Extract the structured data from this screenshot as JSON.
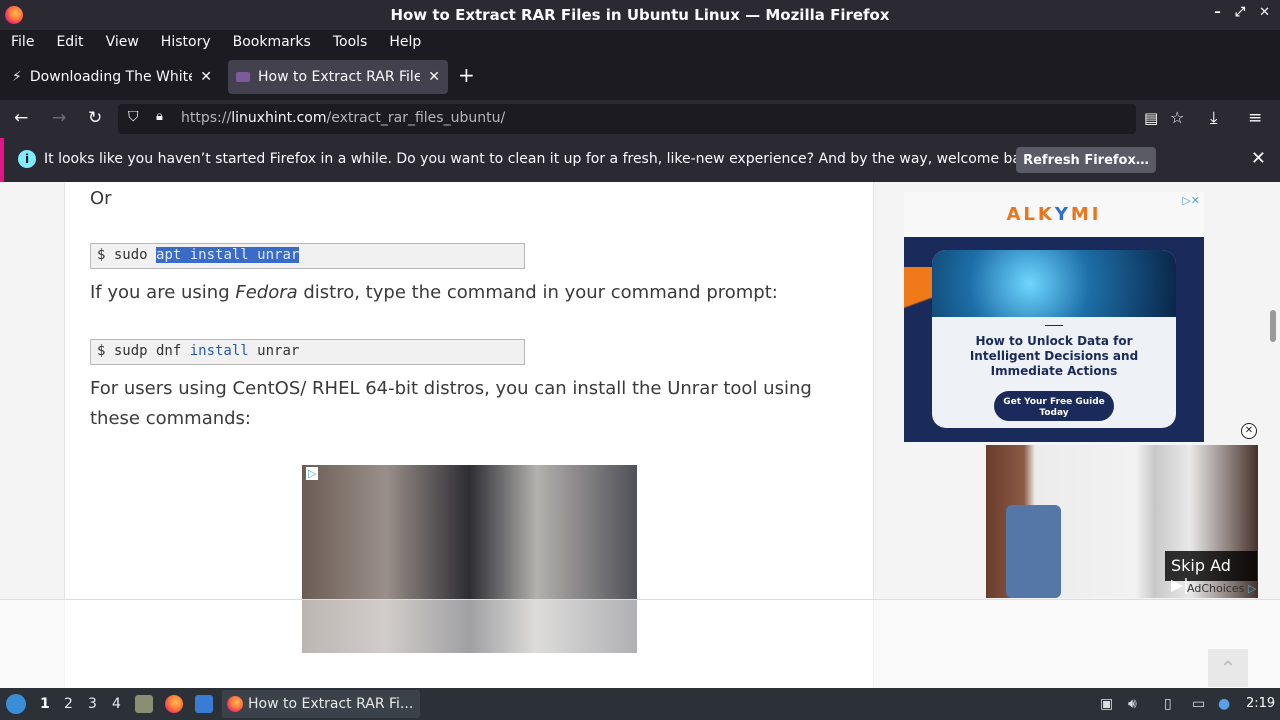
{
  "window": {
    "title": "How to Extract RAR Files in Ubuntu Linux — Mozilla Firefox",
    "controls": [
      "–",
      "⤢",
      "✕"
    ]
  },
  "menubar": [
    "File",
    "Edit",
    "View",
    "History",
    "Bookmarks",
    "Tools",
    "Help"
  ],
  "tabs": [
    {
      "title": "Downloading The White H",
      "active": false
    },
    {
      "title": "How to Extract RAR Files",
      "active": true
    }
  ],
  "newtab_label": "+",
  "urlbar": {
    "prefix": "https://",
    "domain": "linuxhint.com",
    "path": "/extract_rar_files_ubuntu/"
  },
  "notification": {
    "message": "It looks like you haven’t started Firefox in a while. Do you want to clean it up for a fresh, like-new experience? And by the way, welcome back!",
    "button": "Refresh Firefox…",
    "close": "✕"
  },
  "article": {
    "or_text": "Or",
    "code1": {
      "prompt": "$ sudo ",
      "selected": "apt install unrar"
    },
    "fedora": {
      "before": "If you are using ",
      "em": "Fedora",
      "after": " distro, type the command in your command prompt:"
    },
    "code2": {
      "prompt": "$ sudp dnf ",
      "kw": "install",
      "rest": " unrar"
    },
    "centos_line1": "For users using CentOS/ RHEL 64-bit distros, you can install the Unrar tool using",
    "centos_line2": "these commands:"
  },
  "side_ad": {
    "brand_a": "ALK",
    "brand_b": "Y",
    "brand_c": "MI",
    "headline": "How to Unlock Data for Intelligent Decisions and Immediate Actions",
    "cta": "Get Your Free Guide Today"
  },
  "video_ad": {
    "skip": "Skip Ad ▶|",
    "adchoices": "AdChoices"
  },
  "taskbar": {
    "workspaces": [
      "1",
      "2",
      "3",
      "4"
    ],
    "active_workspace": "1",
    "task_title": "How to Extract RAR Fi...",
    "clock": "2:19"
  },
  "colors": {
    "accent": "#e31587",
    "link_blue": "#2a5ca8",
    "selection": "#3a6bc7",
    "ad_orange": "#e8761e",
    "ad_navy": "#1a2a5a"
  }
}
